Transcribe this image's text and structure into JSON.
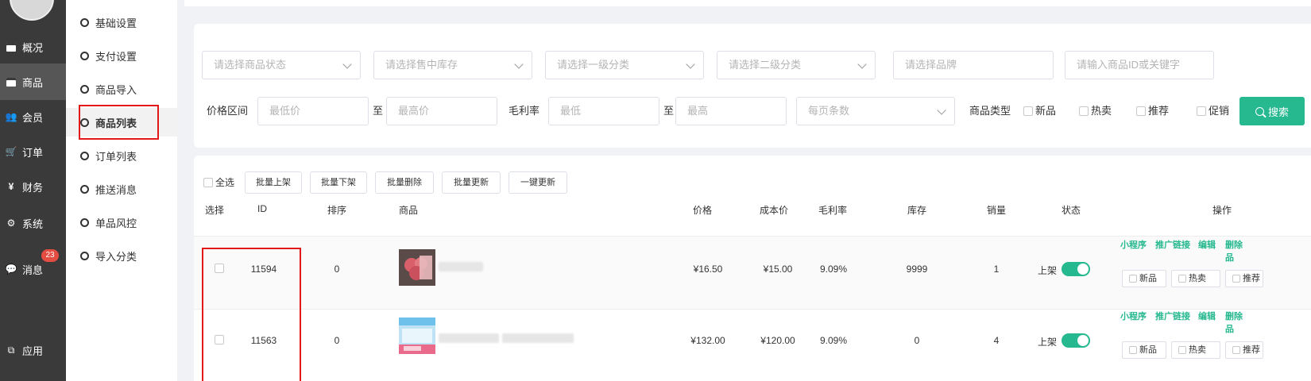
{
  "sidebar": {
    "items": [
      {
        "label": "概况",
        "icon": "archive-icon"
      },
      {
        "label": "商品",
        "icon": "archive-icon"
      },
      {
        "label": "会员",
        "icon": "users-icon"
      },
      {
        "label": "订单",
        "icon": "cart-icon"
      },
      {
        "label": "财务",
        "icon": "yen-icon"
      },
      {
        "label": "系统",
        "icon": "gears-icon"
      },
      {
        "label": "消息",
        "icon": "chat-icon",
        "badge": "23"
      },
      {
        "label": "应用",
        "icon": "cubes-icon"
      }
    ],
    "glyphs": {
      "users": "👥",
      "cart": "🛒",
      "yen": "¥",
      "gears": "⚙",
      "chat": "💬",
      "cubes": "⧉"
    }
  },
  "submenu": {
    "items": [
      "基础设置",
      "支付设置",
      "商品导入",
      "商品列表",
      "订单列表",
      "推送消息",
      "单品风控",
      "导入分类"
    ]
  },
  "filters": {
    "status_placeholder": "请选择商品状态",
    "stock_placeholder": "请选择售中库存",
    "cat1_placeholder": "请选择一级分类",
    "cat2_placeholder": "请选择二级分类",
    "brand_placeholder": "请选择品牌",
    "keyword_placeholder": "请输入商品ID或关键字",
    "price_label": "价格区间",
    "price_min_placeholder": "最低价",
    "to1": "至",
    "price_max_placeholder": "最高价",
    "margin_label": "毛利率",
    "margin_min_placeholder": "最低",
    "to2": "至",
    "margin_max_placeholder": "最高",
    "pagesize_placeholder": "每页条数",
    "type_label": "商品类型",
    "type_new": "新品",
    "type_hot": "热卖",
    "type_recommend": "推荐",
    "type_promo": "促销",
    "search_label": "搜索"
  },
  "batch": {
    "select_all": "全选",
    "up": "批量上架",
    "down": "批量下架",
    "delete": "批量删除",
    "update": "批量更新",
    "one_click": "一键更新"
  },
  "table": {
    "headers": {
      "select": "选择",
      "id": "ID",
      "sort": "排序",
      "product": "商品",
      "price": "价格",
      "cost": "成本价",
      "margin": "毛利率",
      "stock": "库存",
      "sales": "销量",
      "status": "状态",
      "actions": "操作"
    },
    "rows": [
      {
        "id": "11594",
        "sort": "0",
        "price": "¥16.50",
        "cost": "¥15.00",
        "margin": "9.09%",
        "stock": "9999",
        "sales": "1",
        "status": "上架",
        "enabled": true
      },
      {
        "id": "11563",
        "sort": "0",
        "price": "¥132.00",
        "cost": "¥120.00",
        "margin": "9.09%",
        "stock": "0",
        "sales": "4",
        "status": "上架",
        "enabled": true
      }
    ],
    "actions": {
      "miniapp": "小程序",
      "promo_link": "推广链接",
      "edit": "编辑",
      "delete": "删除",
      "delete_tail": "品",
      "new": "新品",
      "hot": "热卖",
      "recommend": "推荐"
    }
  },
  "colors": {
    "accent": "#26b88f",
    "highlight": "#e31818",
    "sidebar": "#3a3a3a"
  }
}
